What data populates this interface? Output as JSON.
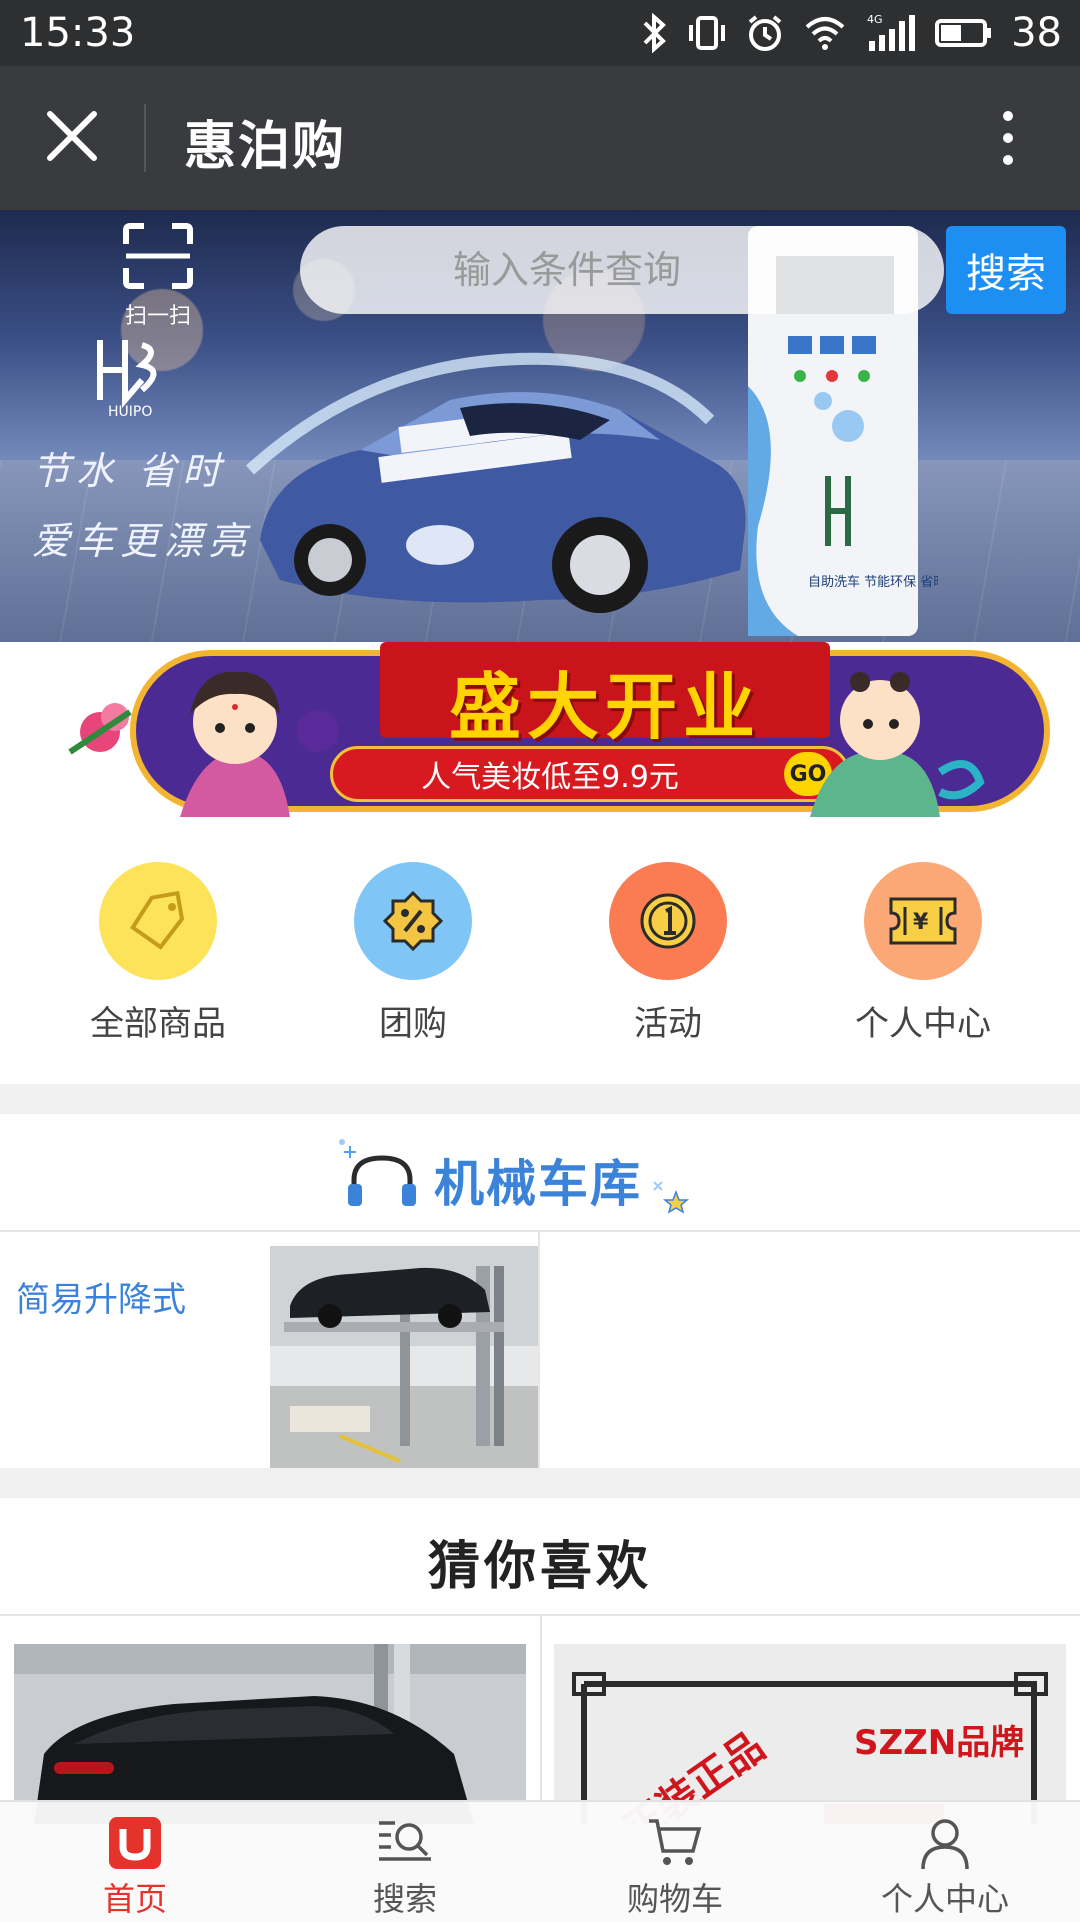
{
  "status_bar": {
    "time": "15:33",
    "battery": "38",
    "network": "4G"
  },
  "title_bar": {
    "title": "惠泊购"
  },
  "banner": {
    "scan_label": "扫一扫",
    "search_placeholder": "输入条件查询",
    "search_button": "搜索",
    "slogan_line1": "节水 省时",
    "slogan_line2": "爱车更漂亮",
    "logo_text": "HUIPO",
    "machine_text": "自助洗车 节能环保 省时更省心"
  },
  "promo": {
    "title": "盛大开业",
    "subtitle": "人气美妆低至9.9元",
    "go": "GO"
  },
  "quick_nav": [
    {
      "label": "全部商品",
      "color": "#fde35a",
      "icon": "tag-icon"
    },
    {
      "label": "团购",
      "color": "#7fc6f6",
      "icon": "percent-badge-icon"
    },
    {
      "label": "活动",
      "color": "#fb7b52",
      "icon": "coin-icon"
    },
    {
      "label": "个人中心",
      "color": "#fca776",
      "icon": "ticket-icon"
    }
  ],
  "section": {
    "title": "机械车库",
    "category": "简易升降式"
  },
  "guess": {
    "title": "猜你喜欢",
    "product2_banner": "正装正品",
    "product2_brand": "SZZN品牌"
  },
  "tabs": [
    {
      "label": "首页",
      "icon": "home-icon",
      "active": true
    },
    {
      "label": "搜索",
      "icon": "search-list-icon",
      "active": false
    },
    {
      "label": "购物车",
      "icon": "cart-icon",
      "active": false
    },
    {
      "label": "个人中心",
      "icon": "user-icon",
      "active": false
    }
  ],
  "colors": {
    "accent_red": "#e5332c",
    "search_blue": "#1d8ff2",
    "section_blue": "#3b82d9"
  }
}
